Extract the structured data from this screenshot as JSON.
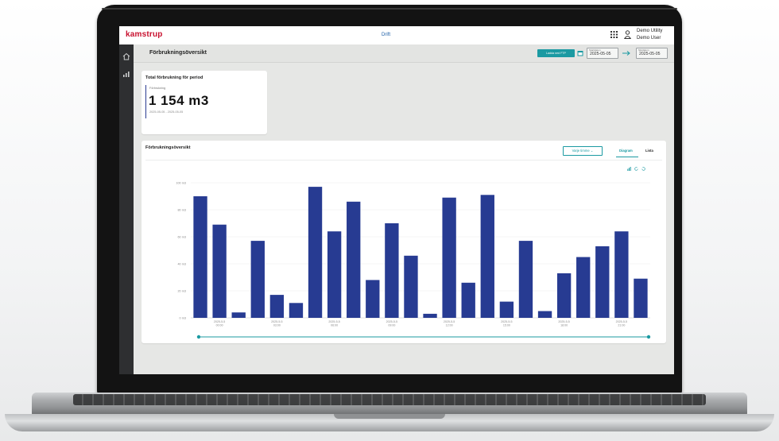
{
  "app": {
    "logo": "kamstrup",
    "title": "Drift",
    "user_line1": "Demo Utility",
    "user_line2": "Demo User"
  },
  "page": {
    "title": "Förbrukningsöversikt",
    "download_label": "Ladda ned FTP",
    "start_label": "Startdatum",
    "start_date": "2025-05-05",
    "end_label": "Slutdatum",
    "end_date": "2025-05-05"
  },
  "total_card": {
    "title": "Total förbrukning för period",
    "label": "Förbrukning",
    "value": "1 154 m3",
    "range": "2025-05-05 - 2025-05-05"
  },
  "chart_card": {
    "title": "Förbrukningsöversikt",
    "interval_select": "Varje timme",
    "tab_diagram": "Diagram",
    "tab_lista": "Lista"
  },
  "icons": {
    "apps": "grid-icon",
    "user": "user-icon",
    "home": "home-icon",
    "stats": "bar-chart-icon",
    "calendar": "calendar-icon",
    "arrow": "arrow-right-icon"
  },
  "colors": {
    "brand_red": "#c8102e",
    "accent_teal": "#1b9aa2",
    "bar_blue": "#273b92"
  },
  "chart_data": {
    "type": "bar",
    "ylim": [
      0,
      100
    ],
    "y_ticks": [
      "0 m3",
      "20 m3",
      "40 m3",
      "60 m3",
      "80 m3",
      "100 m3"
    ],
    "x_tick_labels": [
      {
        "index": 1,
        "line1": "2025-5-5",
        "line2": "00:00"
      },
      {
        "index": 4,
        "line1": "2025-5-5",
        "line2": "03:00"
      },
      {
        "index": 7,
        "line1": "2025-5-5",
        "line2": "06:00"
      },
      {
        "index": 10,
        "line1": "2025-5-5",
        "line2": "09:00"
      },
      {
        "index": 13,
        "line1": "2025-5-5",
        "line2": "12:00"
      },
      {
        "index": 16,
        "line1": "2025-5-5",
        "line2": "15:00"
      },
      {
        "index": 19,
        "line1": "2025-5-5",
        "line2": "18:00"
      },
      {
        "index": 22,
        "line1": "2025-5-5",
        "line2": "21:00"
      }
    ],
    "values": [
      90,
      69,
      4,
      57,
      17,
      11,
      97,
      64,
      86,
      28,
      70,
      46,
      3,
      89,
      26,
      91,
      12,
      57,
      5,
      33,
      45,
      53,
      64,
      29
    ],
    "grid": true
  }
}
